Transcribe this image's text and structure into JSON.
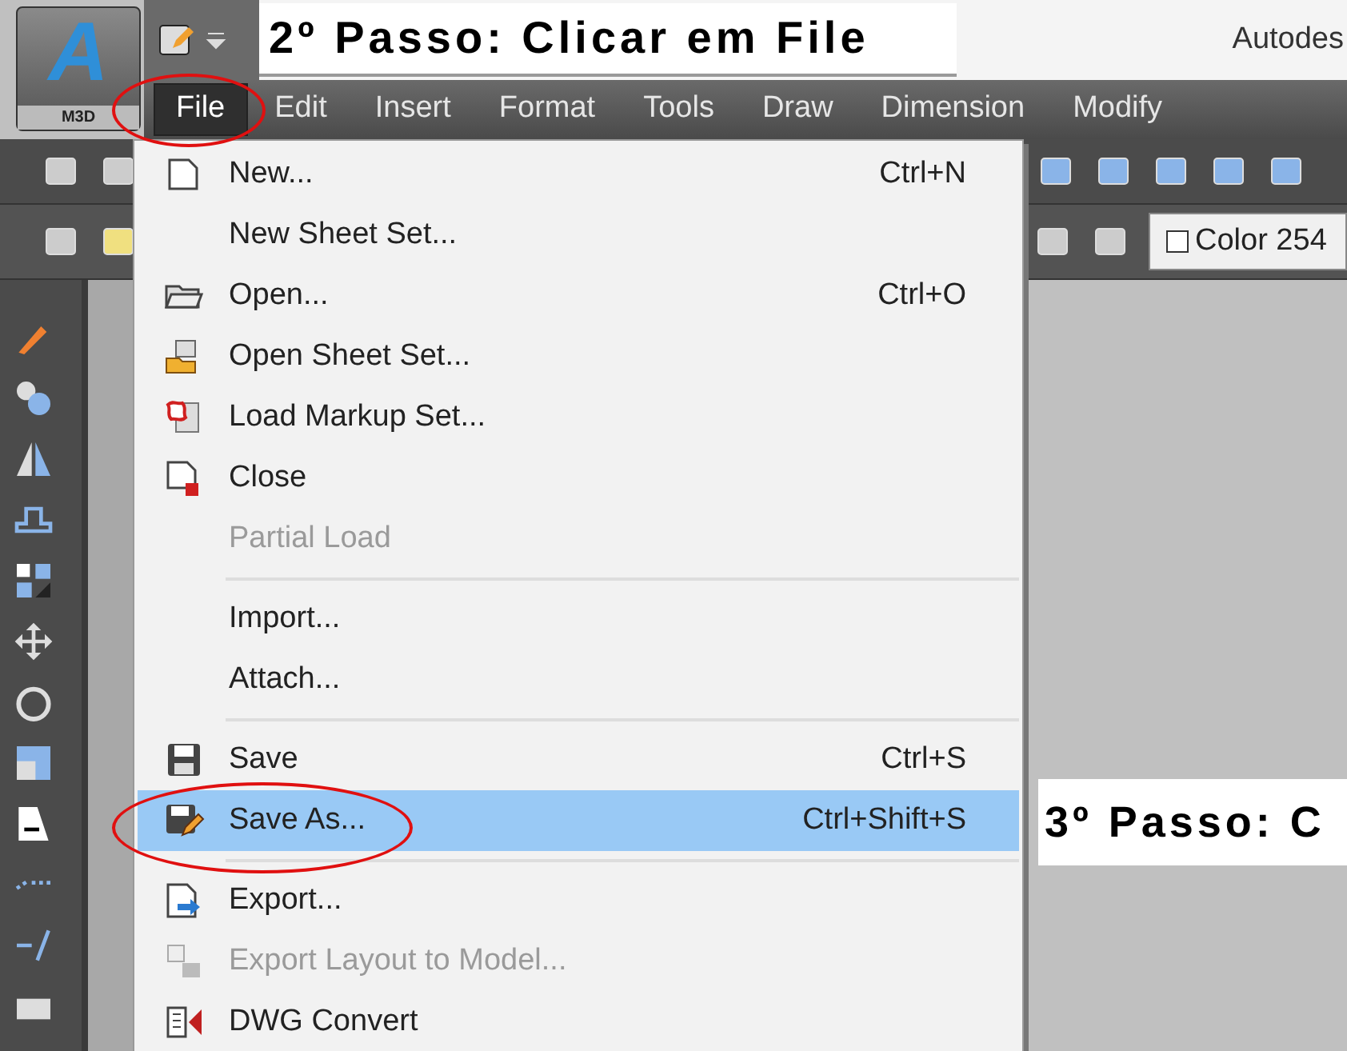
{
  "app_button": {
    "letter": "A",
    "label": "M3D"
  },
  "captions": [
    {
      "text": "2º Passo: Clicar em File"
    },
    {
      "text": "3º Passo: C"
    }
  ],
  "window": {
    "title": "Autodes"
  },
  "menu_bar": [
    {
      "label": "File",
      "selected": true
    },
    {
      "label": "Edit",
      "selected": false
    },
    {
      "label": "Insert",
      "selected": false
    },
    {
      "label": "Format",
      "selected": false
    },
    {
      "label": "Tools",
      "selected": false
    },
    {
      "label": "Draw",
      "selected": false
    },
    {
      "label": "Dimension",
      "selected": false
    },
    {
      "label": "Modify",
      "selected": false
    }
  ],
  "color_control": {
    "label": "Color 254"
  },
  "file_menu": [
    {
      "kind": "item",
      "label": "New...",
      "shortcut": "Ctrl+N",
      "disabled": false,
      "selected": false
    },
    {
      "kind": "item",
      "label": "New Sheet Set...",
      "disabled": false,
      "selected": false
    },
    {
      "kind": "item",
      "label": "Open...",
      "shortcut": "Ctrl+O",
      "disabled": false,
      "selected": false
    },
    {
      "kind": "item",
      "label": "Open Sheet Set...",
      "disabled": false,
      "selected": false
    },
    {
      "kind": "item",
      "label": "Load Markup Set...",
      "disabled": false,
      "selected": false
    },
    {
      "kind": "item",
      "label": "Close",
      "disabled": false,
      "selected": false
    },
    {
      "kind": "item",
      "label": "Partial Load",
      "disabled": true,
      "selected": false
    },
    {
      "kind": "separator"
    },
    {
      "kind": "item",
      "label": "Import...",
      "disabled": false,
      "selected": false
    },
    {
      "kind": "item",
      "label": "Attach...",
      "disabled": false,
      "selected": false
    },
    {
      "kind": "separator"
    },
    {
      "kind": "item",
      "label": "Save",
      "shortcut": "Ctrl+S",
      "disabled": false,
      "selected": false
    },
    {
      "kind": "item",
      "label": "Save As...",
      "shortcut": "Ctrl+Shift+S",
      "disabled": false,
      "selected": true
    },
    {
      "kind": "separator"
    },
    {
      "kind": "item",
      "label": "Export...",
      "disabled": false,
      "selected": false
    },
    {
      "kind": "item",
      "label": "Export Layout to Model...",
      "disabled": true,
      "selected": false
    },
    {
      "kind": "item",
      "label": "DWG Convert",
      "disabled": false,
      "selected": false
    }
  ]
}
